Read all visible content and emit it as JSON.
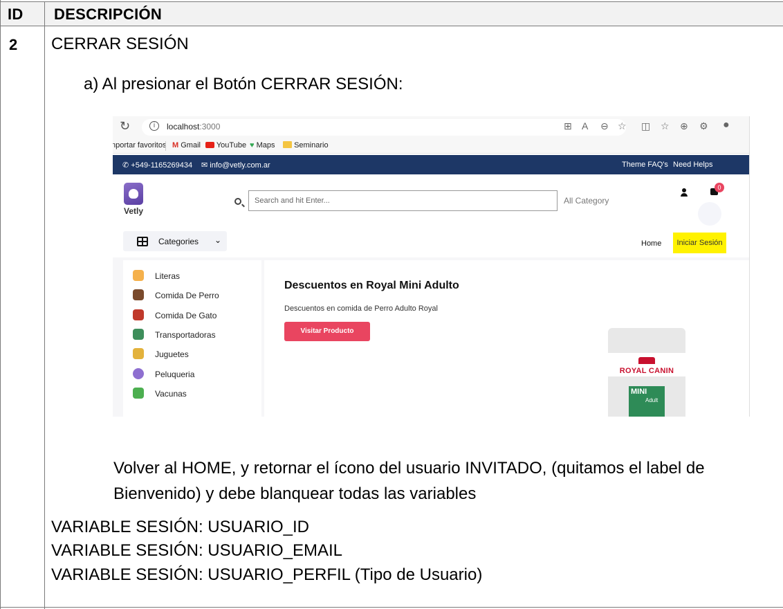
{
  "table": {
    "header_id": "ID",
    "header_desc": "DESCRIPCIÓN",
    "row_id": "2",
    "row_title": "CERRAR SESIÓN",
    "step": "a) Al presionar el Botón CERRAR SESIÓN:",
    "para_line1": "Volver al HOME, y retornar el ícono del usuario INVITADO, (quitamos el label de",
    "para_line2": "Bienvenido) y debe blanquear todas las variables",
    "variables": [
      "VARIABLE SESIÓN: USUARIO_ID",
      "VARIABLE SESIÓN: USUARIO_EMAIL",
      "VARIABLE SESIÓN: USUARIO_PERFIL (Tipo de Usuario)"
    ]
  },
  "browser": {
    "url_host": "localhost",
    "url_port": ":3000",
    "bookmarks": [
      "nportar favoritos",
      "Gmail",
      "YouTube",
      "Maps",
      "Seminario"
    ]
  },
  "site": {
    "phone": "+549-1165269434",
    "email": "info@vetly.com.ar",
    "faq_link": "Theme FAQ's",
    "help_link": "Need Helps",
    "logo_text": "Vetly",
    "search_placeholder": "Search and hit Enter...",
    "category_select": "All Category",
    "cart_count": "0",
    "categories_label": "Categories",
    "nav_home": "Home",
    "nav_login": "Iniciar Sesión",
    "sidebar": [
      "Literas",
      "Comida De Perro",
      "Comida De Gato",
      "Transportadoras",
      "Juguetes",
      "Peluqueria",
      "Vacunas"
    ],
    "banner_title": "Descuentos en Royal Mini Adulto",
    "banner_subtitle": "Descuentos en comida de Perro Adulto Royal",
    "banner_button": "Visitar Producto",
    "product_brand": "ROYAL CANIN",
    "product_line": "MINI",
    "product_age": "Adult"
  },
  "colors": {
    "topbar": "#1d3766",
    "accent": "#e94560",
    "highlight": "#fff200"
  }
}
